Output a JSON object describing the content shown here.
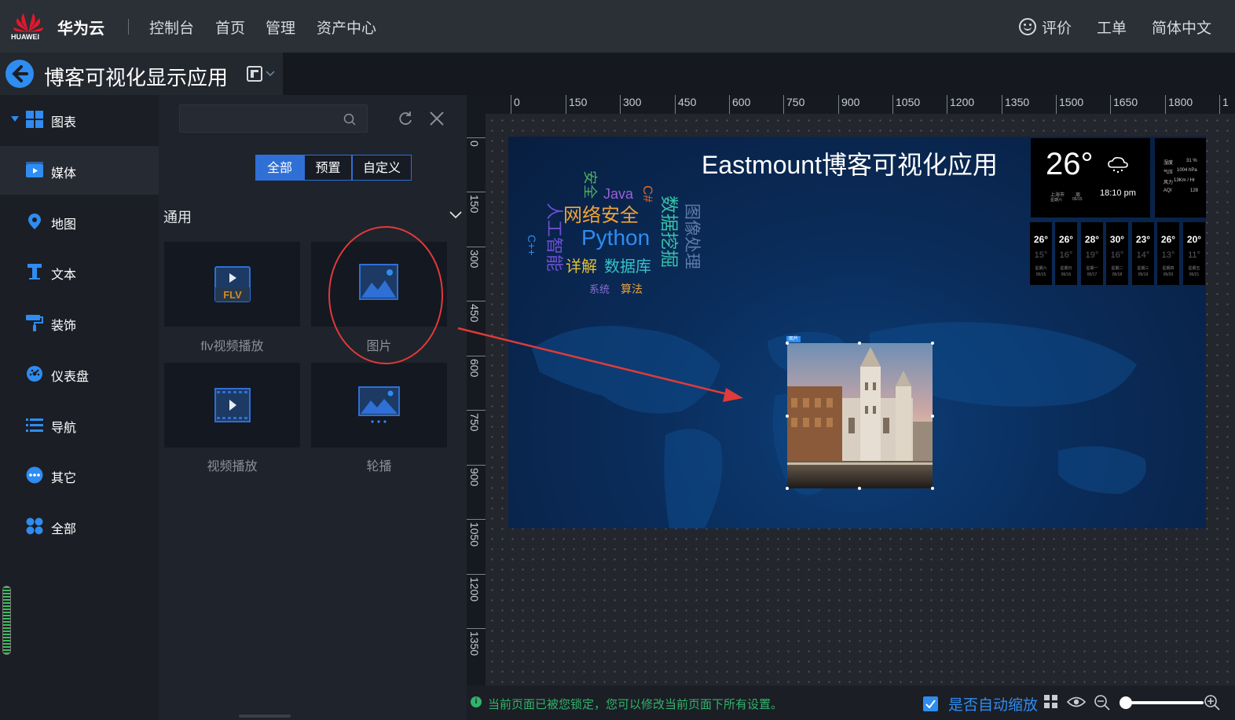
{
  "header": {
    "logo_text": "HUAWEI",
    "brand": "华为云",
    "nav": [
      "控制台",
      "首页",
      "管理",
      "资产中心"
    ],
    "right": {
      "rate": "评价",
      "ticket": "工单",
      "language": "简体中文"
    }
  },
  "page": {
    "title": "博客可视化显示应用"
  },
  "sidebar": {
    "items": [
      {
        "label": "图表",
        "icon": "chart-grid-icon"
      },
      {
        "label": "媒体",
        "icon": "media-icon"
      },
      {
        "label": "地图",
        "icon": "map-pin-icon"
      },
      {
        "label": "文本",
        "icon": "text-icon"
      },
      {
        "label": "装饰",
        "icon": "paint-roller-icon"
      },
      {
        "label": "仪表盘",
        "icon": "gauge-icon"
      },
      {
        "label": "导航",
        "icon": "list-icon"
      },
      {
        "label": "其它",
        "icon": "more-icon"
      },
      {
        "label": "全部",
        "icon": "all-icon"
      }
    ]
  },
  "panel": {
    "search": {
      "value": "",
      "placeholder": ""
    },
    "tabs": [
      "全部",
      "预置",
      "自定义"
    ],
    "section": "通用",
    "components": [
      {
        "label": "flv视频播放",
        "icon": "flv-icon"
      },
      {
        "label": "图片",
        "icon": "image-icon"
      },
      {
        "label": "视频播放",
        "icon": "video-icon"
      },
      {
        "label": "轮播",
        "icon": "carousel-icon"
      }
    ]
  },
  "ruler": {
    "h": [
      "0",
      "150",
      "300",
      "450",
      "600",
      "750",
      "900",
      "1050",
      "1200",
      "1350",
      "1500",
      "1650",
      "1800",
      "1"
    ],
    "v": [
      "0",
      "150",
      "300",
      "450",
      "600",
      "750",
      "900",
      "1050",
      "1200",
      "1350"
    ]
  },
  "screen": {
    "title": "Eastmount博客可视化应用",
    "wordcloud": [
      "安全",
      "Java",
      "C#",
      "数据挖掘",
      "图像处理",
      "人工智能",
      "网络安全",
      "Python",
      "C++",
      "详解",
      "数据库",
      "系统",
      "算法"
    ],
    "weather": {
      "temp": "26°",
      "location": "上海市",
      "weekday": "星期六",
      "date": "05/15",
      "sun": "周",
      "time": "18:10 pm",
      "details": [
        {
          "k": "湿度",
          "v": "31 %"
        },
        {
          "k": "气压",
          "v": "1004 hPa"
        },
        {
          "k": "风力",
          "v": "13Km / Hr"
        },
        {
          "k": "AQI",
          "v": "128"
        }
      ],
      "forecast": [
        {
          "hi": "26°",
          "lo": "15°",
          "day": "星期六",
          "date": "05/15"
        },
        {
          "hi": "26°",
          "lo": "16°",
          "day": "星期日",
          "date": "05/16"
        },
        {
          "hi": "28°",
          "lo": "19°",
          "day": "星期一",
          "date": "05/17"
        },
        {
          "hi": "30°",
          "lo": "16°",
          "day": "星期二",
          "date": "05/18"
        },
        {
          "hi": "23°",
          "lo": "14°",
          "day": "星期三",
          "date": "05/19"
        },
        {
          "hi": "26°",
          "lo": "13°",
          "day": "星期四",
          "date": "05/20"
        },
        {
          "hi": "20°",
          "lo": "11°",
          "day": "星期五",
          "date": "05/21"
        }
      ]
    },
    "selected_tag": "图片"
  },
  "status": {
    "message": "当前页面已被您锁定，您可以修改当前页面下所有设置。",
    "autozoom_label": "是否自动缩放",
    "autozoom_checked": true
  },
  "colors": {
    "accent": "#2f8cf0",
    "success": "#31b36b",
    "annotation": "#e03a3a"
  }
}
